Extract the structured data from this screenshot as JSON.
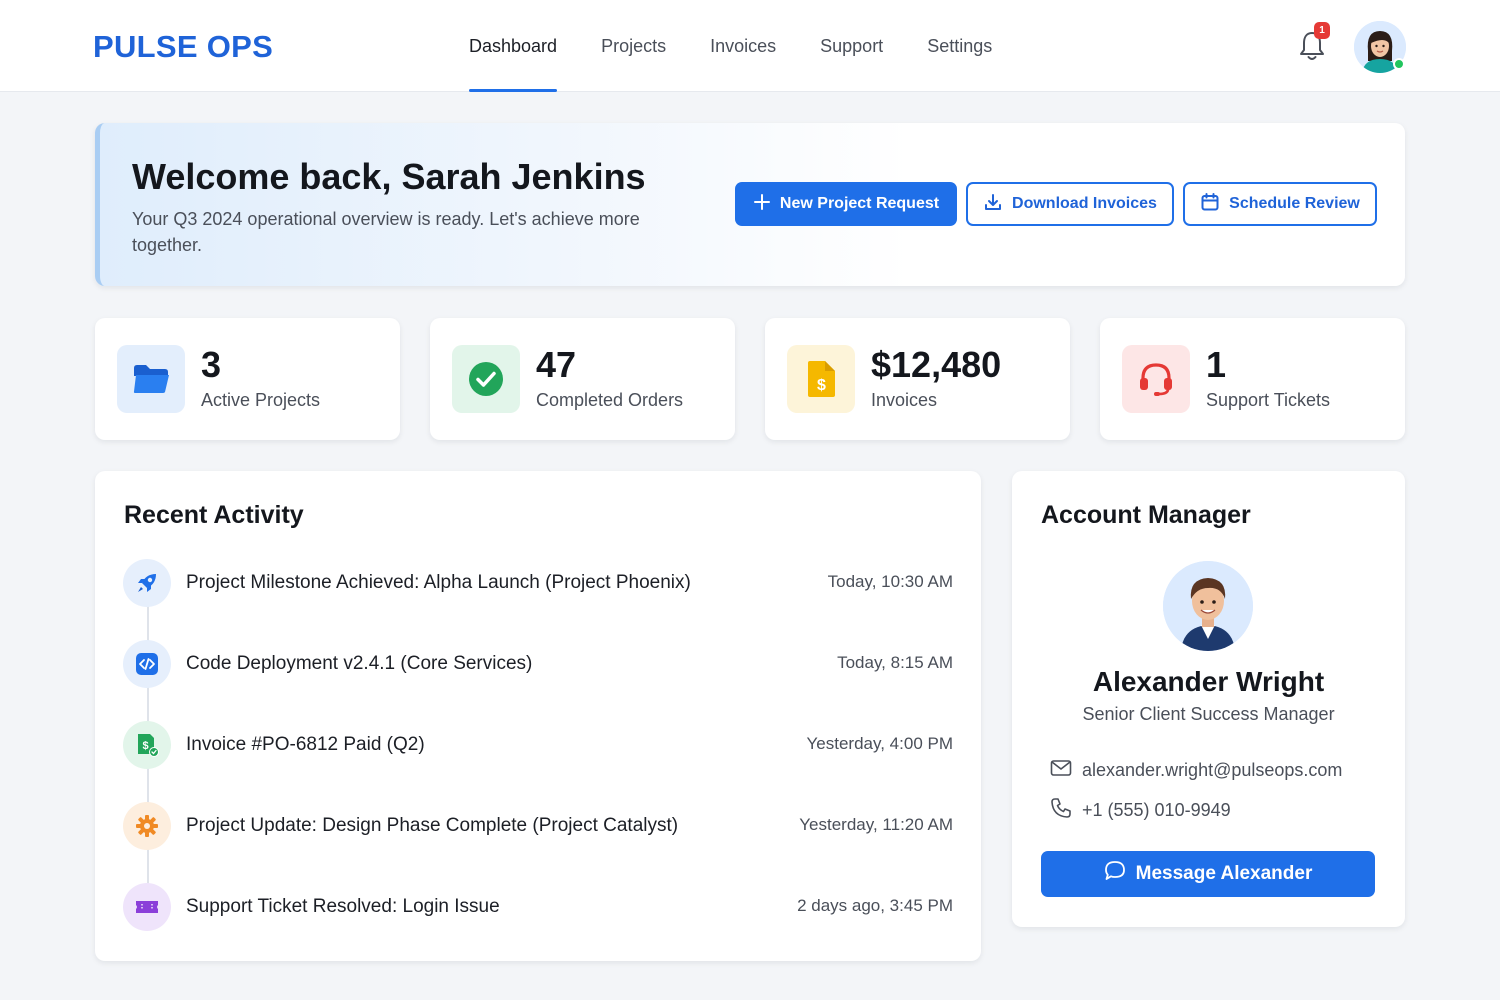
{
  "header": {
    "logo": "PULSE OPS",
    "nav": [
      "Dashboard",
      "Projects",
      "Invoices",
      "Support",
      "Settings"
    ],
    "active_nav": "Dashboard",
    "notification_count": "1"
  },
  "welcome": {
    "title": "Welcome back, Sarah Jenkins",
    "subtitle": "Your Q3 2024 operational overview is ready. Let's achieve more together.",
    "buttons": {
      "new_project": "New Project Request",
      "download": "Download Invoices",
      "schedule": "Schedule Review"
    }
  },
  "stats": [
    {
      "value": "3",
      "label": "Active Projects",
      "icon": "folder-icon",
      "color": "#1f6fe8"
    },
    {
      "value": "47",
      "label": "Completed Orders",
      "icon": "check-circle-icon",
      "color": "#22a55a"
    },
    {
      "value": "$12,480",
      "label": "Invoices",
      "icon": "invoice-icon",
      "color": "#f5b800"
    },
    {
      "value": "1",
      "label": "Support Tickets",
      "icon": "headset-icon",
      "color": "#e53935"
    }
  ],
  "activity": {
    "title": "Recent Activity",
    "items": [
      {
        "text": "Project Milestone Achieved: Alpha Launch (Project Phoenix)",
        "time": "Today, 10:30 AM",
        "icon": "rocket-icon"
      },
      {
        "text": "Code Deployment v2.4.1 (Core Services)",
        "time": "Today, 8:15 AM",
        "icon": "code-icon"
      },
      {
        "text": "Invoice #PO-6812 Paid (Q2)",
        "time": "Yesterday, 4:00 PM",
        "icon": "invoice-paid-icon"
      },
      {
        "text": "Project Update: Design Phase Complete (Project Catalyst)",
        "time": "Yesterday, 11:20 AM",
        "icon": "gear-icon"
      },
      {
        "text": "Support Ticket Resolved: Login Issue",
        "time": "2 days ago, 3:45 PM",
        "icon": "ticket-icon"
      }
    ]
  },
  "manager": {
    "title": "Account Manager",
    "name": "Alexander Wright",
    "role": "Senior Client Success Manager",
    "email": "alexander.wright@pulseops.com",
    "phone": "+1 (555) 010-9949",
    "button": "Message Alexander"
  },
  "colors": {
    "accent": "#1f6fe8",
    "brand": "#1f63d8"
  }
}
